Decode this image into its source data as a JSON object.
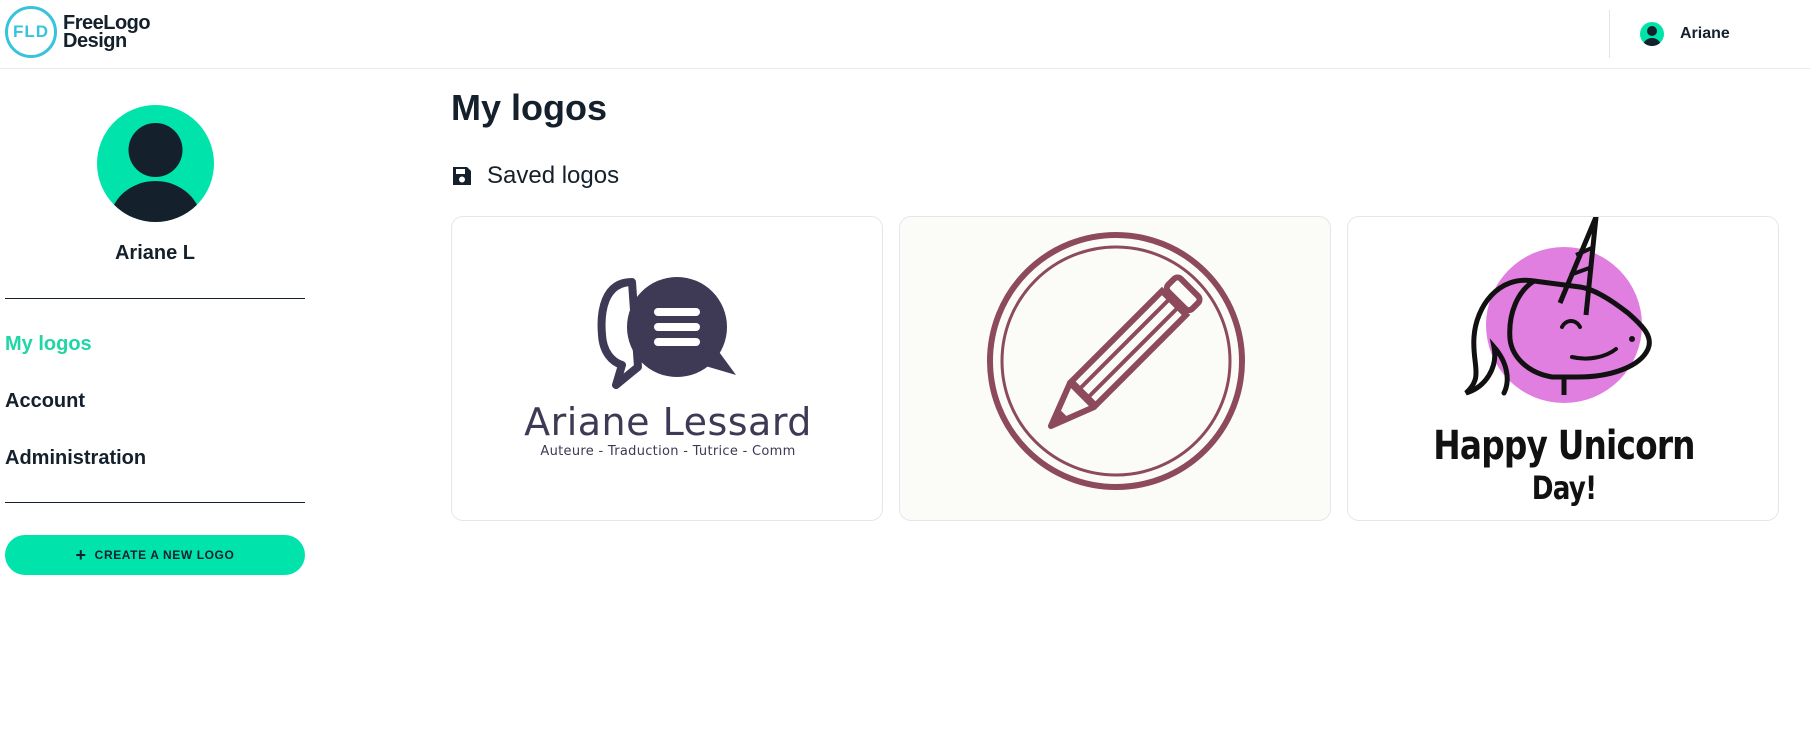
{
  "header": {
    "brand_mark": "FLD",
    "brand_line1": "FreeLogo",
    "brand_line2": "Design",
    "user_name": "Ariane"
  },
  "sidebar": {
    "profile_name": "Ariane L",
    "nav": [
      {
        "label": "My logos",
        "active": true
      },
      {
        "label": "Account",
        "active": false
      },
      {
        "label": "Administration",
        "active": false
      }
    ],
    "create_button": "CREATE A NEW LOGO"
  },
  "main": {
    "title": "My logos",
    "section_label": "Saved logos",
    "logos": [
      {
        "name": "Ariane Lessard",
        "tagline": "Auteure - Traduction - Tutrice - Comm"
      },
      {
        "name": ""
      },
      {
        "line1": "Happy Unicorn",
        "line2": "Day!"
      }
    ]
  },
  "colors": {
    "accent": "#00e3aa",
    "active_nav": "#1fd6a5",
    "brand_ring": "#37c3dd",
    "dark": "#14202b",
    "logo1_ink": "#3e3954",
    "logo2_ink": "#8c4a5c",
    "logo3_pink": "#e07fe0"
  },
  "icons": {
    "brand": "fld-logo-icon",
    "avatar": "user-avatar-icon",
    "section": "floppy-disk-icon",
    "create": "plus-icon"
  }
}
